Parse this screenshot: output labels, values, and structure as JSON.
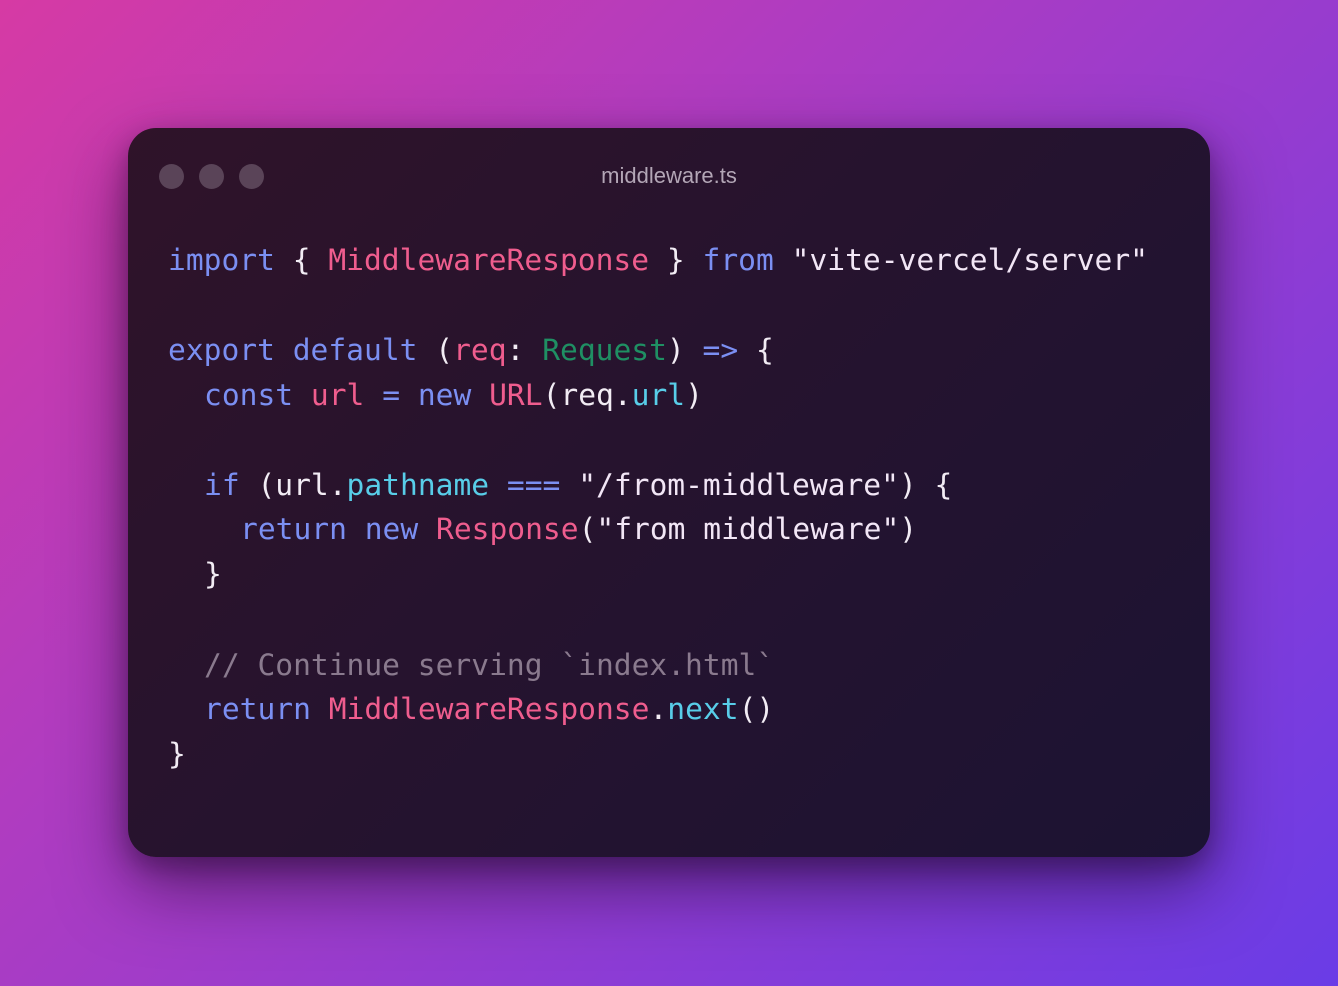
{
  "window": {
    "filename": "middleware.ts"
  },
  "code": {
    "line1": {
      "import": "import",
      "brace_open": " { ",
      "type": "MiddlewareResponse",
      "brace_close": " } ",
      "from": "from",
      "space": " ",
      "module": "\"vite-vercel/server\""
    },
    "line3": {
      "export": "export",
      "space1": " ",
      "default": "default",
      "paren": " (",
      "param": "req",
      "colon": ": ",
      "ptype": "Request",
      "close": ") ",
      "arrow": "=>",
      "brace": " {"
    },
    "line4": {
      "const": "const",
      "space1": " ",
      "var": "url",
      "eq": " = ",
      "new": "new",
      "space2": " ",
      "ctor": "URL",
      "args_open": "(req.",
      "prop": "url",
      "args_close": ")"
    },
    "line6": {
      "if": "if",
      "open": " (url.",
      "prop": "pathname",
      "space1": " ",
      "op": "===",
      "space2": " ",
      "str": "\"/from-middleware\"",
      "close": ") {"
    },
    "line7": {
      "return": "return",
      "space1": " ",
      "new": "new",
      "space2": " ",
      "ctor": "Response",
      "open": "(",
      "str": "\"from middleware\"",
      "close": ")"
    },
    "line8": {
      "brace": "}"
    },
    "line10": {
      "comment": "// Continue serving `index.html`"
    },
    "line11": {
      "return": "return",
      "space1": " ",
      "type": "MiddlewareResponse",
      "dot": ".",
      "method": "next",
      "call": "()"
    },
    "line12": {
      "brace": "}"
    }
  }
}
